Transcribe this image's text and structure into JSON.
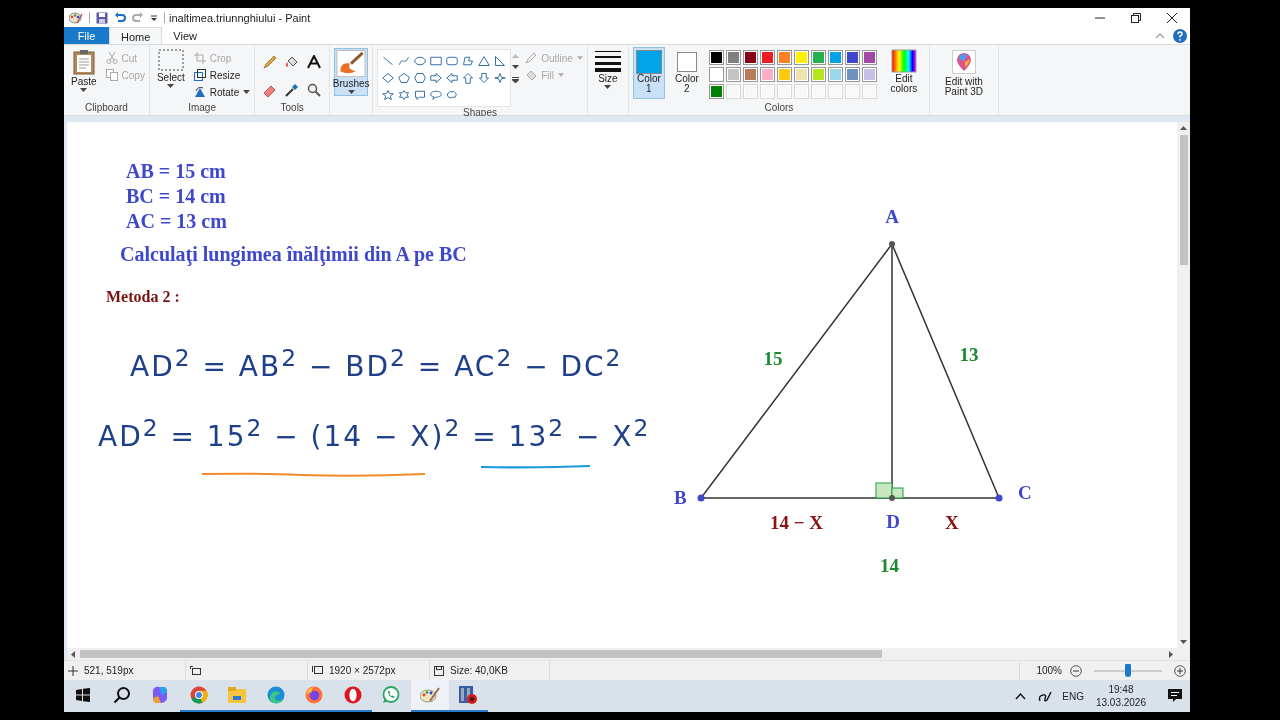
{
  "window": {
    "title": "inaltimea.triunnghiului - Paint"
  },
  "tabs": [
    {
      "label": "File",
      "kind": "file",
      "selected": false
    },
    {
      "label": "Home",
      "kind": "tab",
      "selected": true
    },
    {
      "label": "View",
      "kind": "tab",
      "selected": false
    }
  ],
  "ribbon": {
    "clipboard": {
      "label": "Clipboard",
      "paste": "Paste",
      "cut": {
        "label": "Cut",
        "disabled": true
      },
      "copy": {
        "label": "Copy",
        "disabled": true
      }
    },
    "image": {
      "label": "Image",
      "select": "Select",
      "crop": {
        "label": "Crop",
        "disabled": true
      },
      "resize": {
        "label": "Resize",
        "disabled": false
      },
      "rotate": {
        "label": "Rotate",
        "disabled": false
      }
    },
    "tools": {
      "label": "Tools"
    },
    "brushes": {
      "label": "Brushes",
      "selected": true
    },
    "shapes": {
      "label": "Shapes",
      "outline": {
        "label": "Outline",
        "disabled": true
      },
      "fill": {
        "label": "Fill",
        "disabled": true
      }
    },
    "size": {
      "label": "Size"
    },
    "colors": {
      "label": "Colors",
      "slots": [
        {
          "label": "Color 1",
          "color": "#00a2e8",
          "selected": true
        },
        {
          "label": "Color 2",
          "color": "#ffffff",
          "selected": false
        }
      ],
      "palette": [
        {
          "kind": "color",
          "color": "#000000"
        },
        {
          "kind": "color",
          "color": "#7f7f7f"
        },
        {
          "kind": "color",
          "color": "#880015"
        },
        {
          "kind": "color",
          "color": "#ed1c24"
        },
        {
          "kind": "color",
          "color": "#ff7f27"
        },
        {
          "kind": "color",
          "color": "#fff200"
        },
        {
          "kind": "color",
          "color": "#22b14c"
        },
        {
          "kind": "color",
          "color": "#00a2e8"
        },
        {
          "kind": "color",
          "color": "#3f48cc"
        },
        {
          "kind": "color",
          "color": "#a349a4"
        },
        {
          "kind": "color",
          "color": "#ffffff"
        },
        {
          "kind": "color",
          "color": "#c3c3c3"
        },
        {
          "kind": "color",
          "color": "#b97a57"
        },
        {
          "kind": "color",
          "color": "#ffaec9"
        },
        {
          "kind": "color",
          "color": "#ffc90e"
        },
        {
          "kind": "color",
          "color": "#efe4b0"
        },
        {
          "kind": "color",
          "color": "#b5e61d"
        },
        {
          "kind": "color",
          "color": "#99d9ea"
        },
        {
          "kind": "color",
          "color": "#7092be"
        },
        {
          "kind": "color",
          "color": "#c8bfe7"
        },
        {
          "kind": "color",
          "color": "#008000"
        },
        {
          "kind": "empty"
        },
        {
          "kind": "empty"
        },
        {
          "kind": "empty"
        },
        {
          "kind": "empty"
        },
        {
          "kind": "empty"
        },
        {
          "kind": "empty"
        },
        {
          "kind": "empty"
        },
        {
          "kind": "empty"
        },
        {
          "kind": "empty"
        }
      ],
      "edit_colors": "Edit colors"
    },
    "paint3d": "Edit with Paint 3D"
  },
  "canvas": {
    "given": [
      "AB = 15 cm",
      "BC = 14 cm",
      "AC = 13 cm"
    ],
    "question": "Calculaţi lungimea înălţimii din A pe BC",
    "method": "Metoda 2 :",
    "equations": [
      "AD$^{2}$ = AB$^{2}$ − BD$^{2}$ = AC$^{2}$ − DC$^{2}$",
      "AD$^{2}$ = 15$^{2}$ − (14 − X)$^{2}$ = 13$^{2}$ − X$^{2}$"
    ],
    "triangle": {
      "vertex_labels": [
        "A",
        "B",
        "C",
        "D"
      ],
      "side_labels": [
        "15",
        "13"
      ],
      "segment_labels": [
        "14 − X",
        "X"
      ],
      "base_label": "14"
    }
  },
  "status_bar": {
    "cursor": "521, 519px",
    "dimensions": "1920 × 2572px",
    "file_size": "Size: 40,0KB",
    "zoom": {
      "label": "100%",
      "level": 0.5
    }
  },
  "taskbar": {
    "apps": [
      {
        "kind": "copilot",
        "running": false,
        "selected": false
      },
      {
        "kind": "chrome",
        "running": true,
        "selected": false
      },
      {
        "kind": "explorer",
        "running": true,
        "selected": false
      },
      {
        "kind": "edge",
        "running": true,
        "selected": false
      },
      {
        "kind": "firefox",
        "running": true,
        "selected": false
      },
      {
        "kind": "opera",
        "running": true,
        "selected": false
      },
      {
        "kind": "whatsapp",
        "running": false,
        "selected": false
      },
      {
        "kind": "paint",
        "running": true,
        "selected": true
      },
      {
        "kind": "video",
        "running": true,
        "selected": false
      }
    ],
    "tray": {
      "language": "ENG",
      "time": "19:48",
      "date": "13.03.2026"
    }
  }
}
